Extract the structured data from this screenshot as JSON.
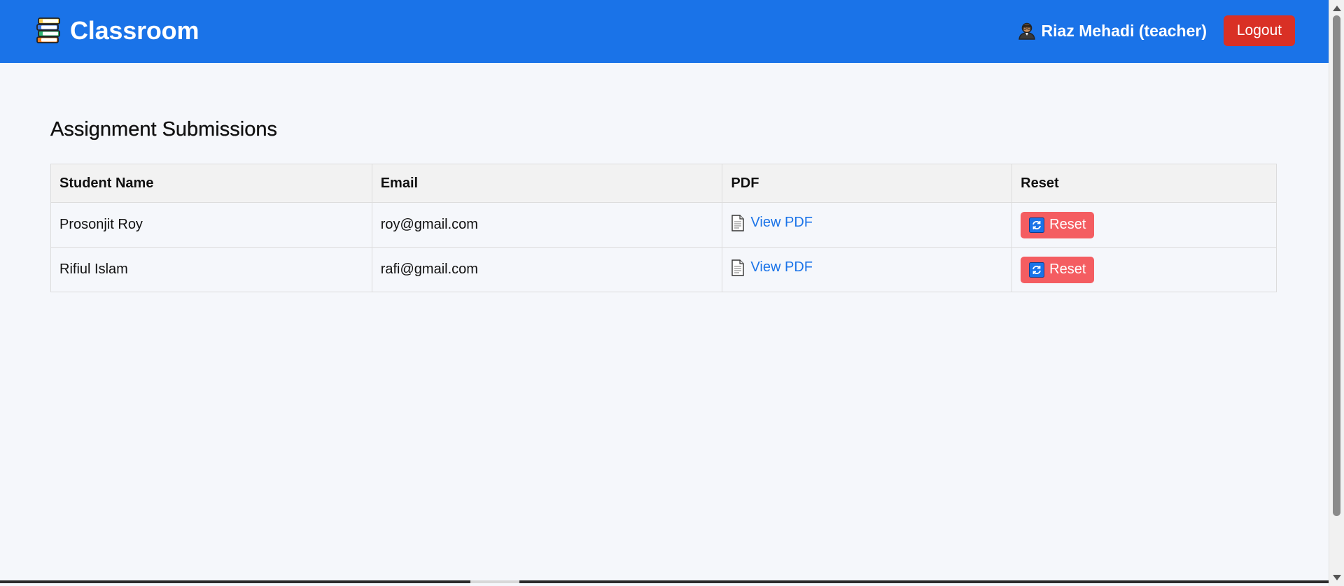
{
  "header": {
    "app_title": "Classroom",
    "logo_icon": "books-stack-icon",
    "user_icon": "teacher-person-icon",
    "user_label": "Riaz Mehadi (teacher)",
    "logout_label": "Logout",
    "colors": {
      "bar": "#1a73e8",
      "logout": "#d93025"
    }
  },
  "main": {
    "heading": "Assignment Submissions",
    "table": {
      "columns": [
        "Student Name",
        "Email",
        "PDF",
        "Reset"
      ],
      "rows": [
        {
          "name": "Prosonjit Roy",
          "email": "roy@gmail.com",
          "pdf_label": "View PDF",
          "reset_label": "Reset"
        },
        {
          "name": "Rifiul Islam",
          "email": "rafi@gmail.com",
          "pdf_label": "View PDF",
          "reset_label": "Reset"
        }
      ]
    },
    "colors": {
      "link": "#1a73e8",
      "reset_button": "#f45d61"
    }
  }
}
